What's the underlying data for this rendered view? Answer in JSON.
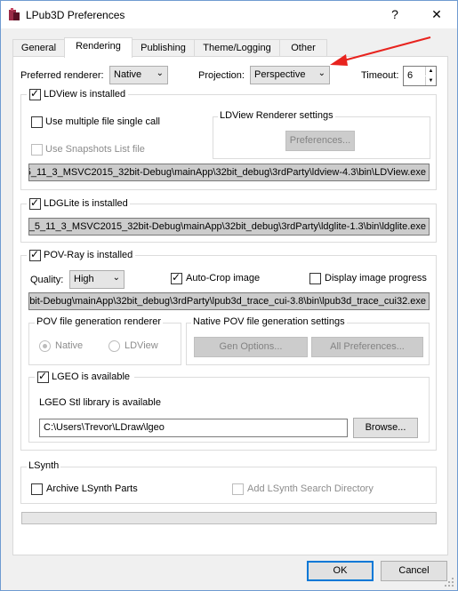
{
  "window": {
    "title": "LPub3D Preferences",
    "help_glyph": "?",
    "close_glyph": "✕"
  },
  "tabs": [
    "General",
    "Rendering",
    "Publishing",
    "Theme/Logging",
    "Other"
  ],
  "top_row": {
    "preferred_renderer_label": "Preferred renderer:",
    "preferred_renderer_value": "Native",
    "projection_label": "Projection:",
    "projection_value": "Perspective",
    "timeout_label": "Timeout:",
    "timeout_value": "6"
  },
  "ldview": {
    "installed_label": "LDView is installed",
    "multi_file_label": "Use multiple file single call",
    "snapshots_label": "Use Snapshots List file",
    "renderer_settings_label": "LDView Renderer settings",
    "preferences_button": "Preferences...",
    "path": "5_11_3_MSVC2015_32bit-Debug\\mainApp\\32bit_debug\\3rdParty\\ldview-4.3\\bin\\LDView.exe"
  },
  "ldglite": {
    "installed_label": "LDGLite is installed",
    "path": "_5_11_3_MSVC2015_32bit-Debug\\mainApp\\32bit_debug\\3rdParty\\ldglite-1.3\\bin\\ldglite.exe"
  },
  "povray": {
    "installed_label": "POV-Ray is installed",
    "quality_label": "Quality:",
    "quality_value": "High",
    "autocrop_label": "Auto-Crop image",
    "display_progress_label": "Display image progress",
    "path": "bit-Debug\\mainApp\\32bit_debug\\3rdParty\\lpub3d_trace_cui-3.8\\bin\\lpub3d_trace_cui32.exe",
    "gen_renderer_label": "POV file generation renderer",
    "native_label": "Native",
    "ldview_label": "LDView",
    "native_settings_label": "Native POV file generation settings",
    "gen_options_button": "Gen Options...",
    "all_prefs_button": "All Preferences...",
    "lgeo_available_label": "LGEO is available",
    "lgeo_stl_label": "LGEO Stl library is available",
    "lgeo_path": "C:\\Users\\Trevor\\LDraw\\lgeo",
    "browse_button": "Browse..."
  },
  "lsynth": {
    "group_label": "LSynth",
    "archive_label": "Archive LSynth Parts",
    "search_dir_label": "Add LSynth Search Directory"
  },
  "footer": {
    "ok_button": "OK",
    "cancel_button": "Cancel"
  },
  "colors": {
    "arrow": "#e8231e",
    "accent": "#0078d7"
  }
}
